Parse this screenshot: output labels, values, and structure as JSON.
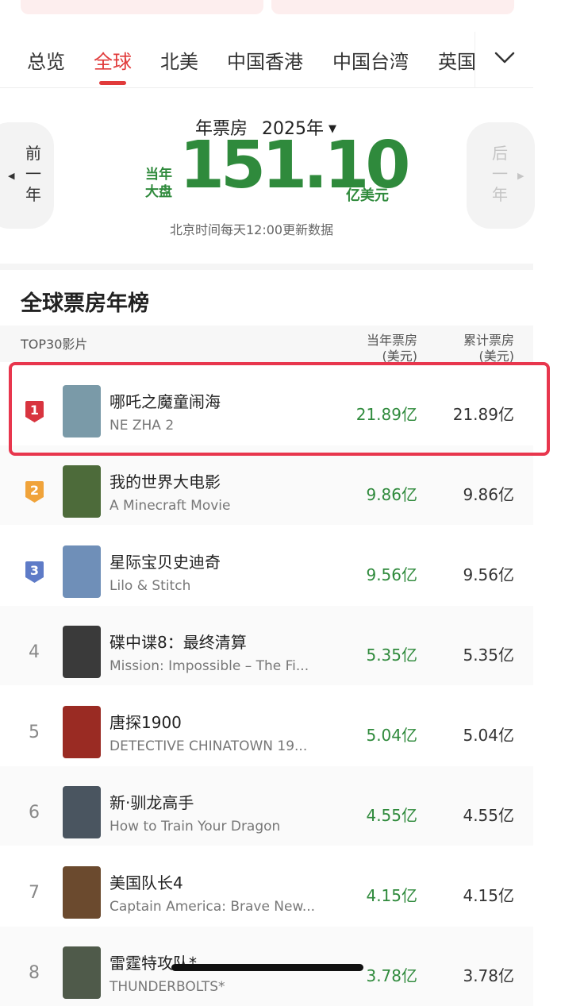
{
  "tabs": [
    "总览",
    "全球",
    "北美",
    "中国香港",
    "中国台湾",
    "英国"
  ],
  "active_tab": "全球",
  "summary": {
    "prev_year_label": "前一年",
    "next_year_label": "后一年",
    "title": "年票房",
    "selected_year": "2025年",
    "current_label_line1": "当年",
    "current_label_line2": "大盘",
    "total": "151.10",
    "unit": "亿美元",
    "update_note": "北京时间每天12:00更新数据"
  },
  "list": {
    "title": "全球票房年榜",
    "headers": {
      "film": "TOP30影片",
      "year_box_line1": "当年票房",
      "year_box_line2": "(美元)",
      "cum_box_line1": "累计票房",
      "cum_box_line2": "(美元)"
    },
    "rows": [
      {
        "rank": "1",
        "title_cn": "哪吒之魔童闹海",
        "title_en": "NE ZHA 2",
        "year_box": "21.89亿",
        "cum_box": "21.89亿",
        "badge_color": "#d8343f",
        "poster_color": "#7a9aa8"
      },
      {
        "rank": "2",
        "title_cn": "我的世界大电影",
        "title_en": "A Minecraft Movie",
        "year_box": "9.86亿",
        "cum_box": "9.86亿",
        "badge_color": "#f0a33a",
        "poster_color": "#4d6b3a"
      },
      {
        "rank": "3",
        "title_cn": "星际宝贝史迪奇",
        "title_en": "Lilo & Stitch",
        "year_box": "9.56亿",
        "cum_box": "9.56亿",
        "badge_color": "#5e7bc7",
        "poster_color": "#6f8fb8"
      },
      {
        "rank": "4",
        "title_cn": "碟中谍8：最终清算",
        "title_en": "Mission: Impossible – The Fi...",
        "year_box": "5.35亿",
        "cum_box": "5.35亿",
        "poster_color": "#3a3a3a"
      },
      {
        "rank": "5",
        "title_cn": "唐探1900",
        "title_en": "DETECTIVE CHINATOWN 19...",
        "year_box": "5.04亿",
        "cum_box": "5.04亿",
        "poster_color": "#9a2b23"
      },
      {
        "rank": "6",
        "title_cn": "新·驯龙高手",
        "title_en": "How to Train Your Dragon",
        "year_box": "4.55亿",
        "cum_box": "4.55亿",
        "poster_color": "#4a5560"
      },
      {
        "rank": "7",
        "title_cn": "美国队长4",
        "title_en": "Captain America: Brave New...",
        "year_box": "4.15亿",
        "cum_box": "4.15亿",
        "poster_color": "#6b4a2e"
      },
      {
        "rank": "8",
        "title_cn": "雷霆特攻队*",
        "title_en": "THUNDERBOLTS*",
        "year_box": "3.78亿",
        "cum_box": "3.78亿",
        "poster_color": "#4f5a4a"
      }
    ]
  },
  "colors": {
    "accent_red": "#e13a3a",
    "box_green": "#2f8a3c",
    "highlight": "#e8364d"
  }
}
